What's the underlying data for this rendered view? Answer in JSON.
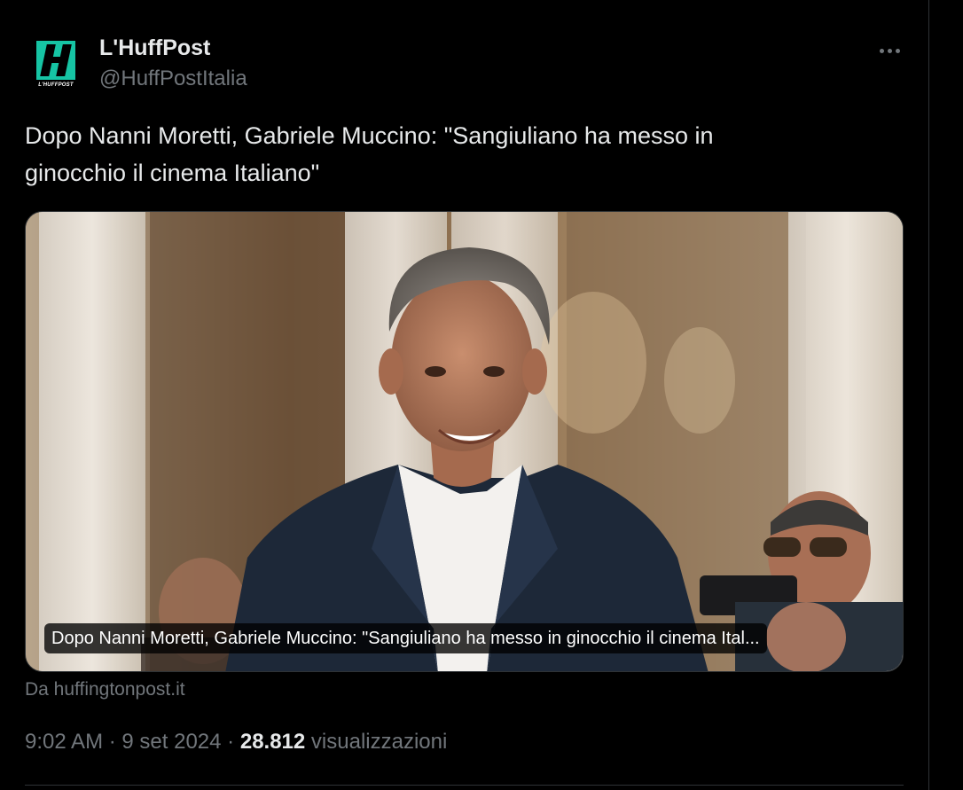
{
  "author": {
    "display_name": "L'HuffPost",
    "handle": "@HuffPostItalia",
    "logo_caption": "L'HUFFPOST",
    "logo_color": "#16c4a4"
  },
  "tweet": {
    "text": "Dopo Nanni Moretti, Gabriele Muccino: \"Sangiuliano ha messo in\nginocchio il cinema Italiano\""
  },
  "card": {
    "caption": "Dopo Nanni Moretti, Gabriele Muccino: \"Sangiuliano ha messo in ginocchio il cinema Ital...",
    "source": "Da huffingtonpost.it"
  },
  "meta": {
    "time": "9:02 AM",
    "separator": "·",
    "date": "9 set 2024",
    "views_count": "28.812",
    "views_label": "visualizzazioni"
  },
  "icons": {
    "more": "more-horizontal-icon"
  },
  "colors": {
    "background": "#000000",
    "text_primary": "#e7e9ea",
    "text_secondary": "#71767b",
    "border": "#2f3336"
  }
}
